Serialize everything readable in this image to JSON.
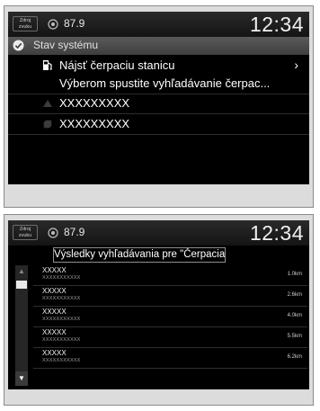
{
  "screen1": {
    "status": {
      "source_label": "Zdroj zvuku",
      "station": "87.9",
      "clock": "12:34"
    },
    "menu": {
      "header": "Stav systému",
      "fuel_item": "Nájsť čerpaciu stanicu",
      "fuel_subtitle": "Výberom spustite vyhľadávanie čerpac...",
      "items": [
        "XXXXXXXXX",
        "XXXXXXXXX"
      ]
    }
  },
  "screen2": {
    "status": {
      "source_label": "Zdroj zvuku",
      "station": "87.9",
      "clock": "12:34"
    },
    "title": "Výsledky vyhľadávania pre \"Čerpacia ...",
    "results": [
      {
        "name": "XXXXX",
        "address": "XXXXXXXXXXX",
        "distance": "1.0km"
      },
      {
        "name": "XXXXX",
        "address": "XXXXXXXXXXX",
        "distance": "2.6km"
      },
      {
        "name": "XXXXX",
        "address": "XXXXXXXXXXX",
        "distance": "4.0km"
      },
      {
        "name": "XXXXX",
        "address": "XXXXXXXXXXX",
        "distance": "5.5km"
      },
      {
        "name": "XXXXX",
        "address": "XXXXXXXXXXX",
        "distance": "6.2km"
      }
    ]
  }
}
